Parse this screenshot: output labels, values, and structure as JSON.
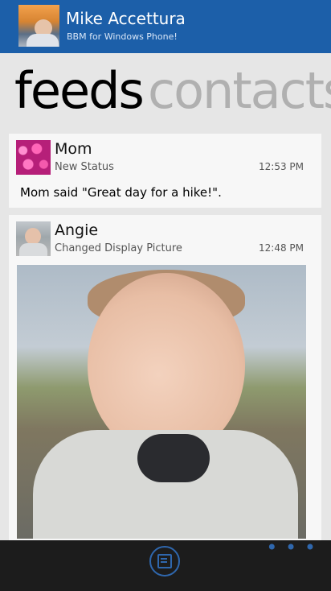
{
  "header": {
    "name": "Mike Accettura",
    "status": "BBM for Windows Phone!"
  },
  "pivot": {
    "tabs": [
      {
        "label": "feeds"
      },
      {
        "label": "contacts"
      }
    ]
  },
  "feed": {
    "items": [
      {
        "sender": "Mom",
        "activity": "New Status",
        "time": "12:53 PM",
        "message": "Mom said \"Great day for a hike!\"."
      },
      {
        "sender": "Angie",
        "activity": "Changed Display Picture",
        "time": "12:48 PM"
      }
    ]
  },
  "appbar": {
    "compose_icon": "compose-icon",
    "more_label": "• • •"
  }
}
